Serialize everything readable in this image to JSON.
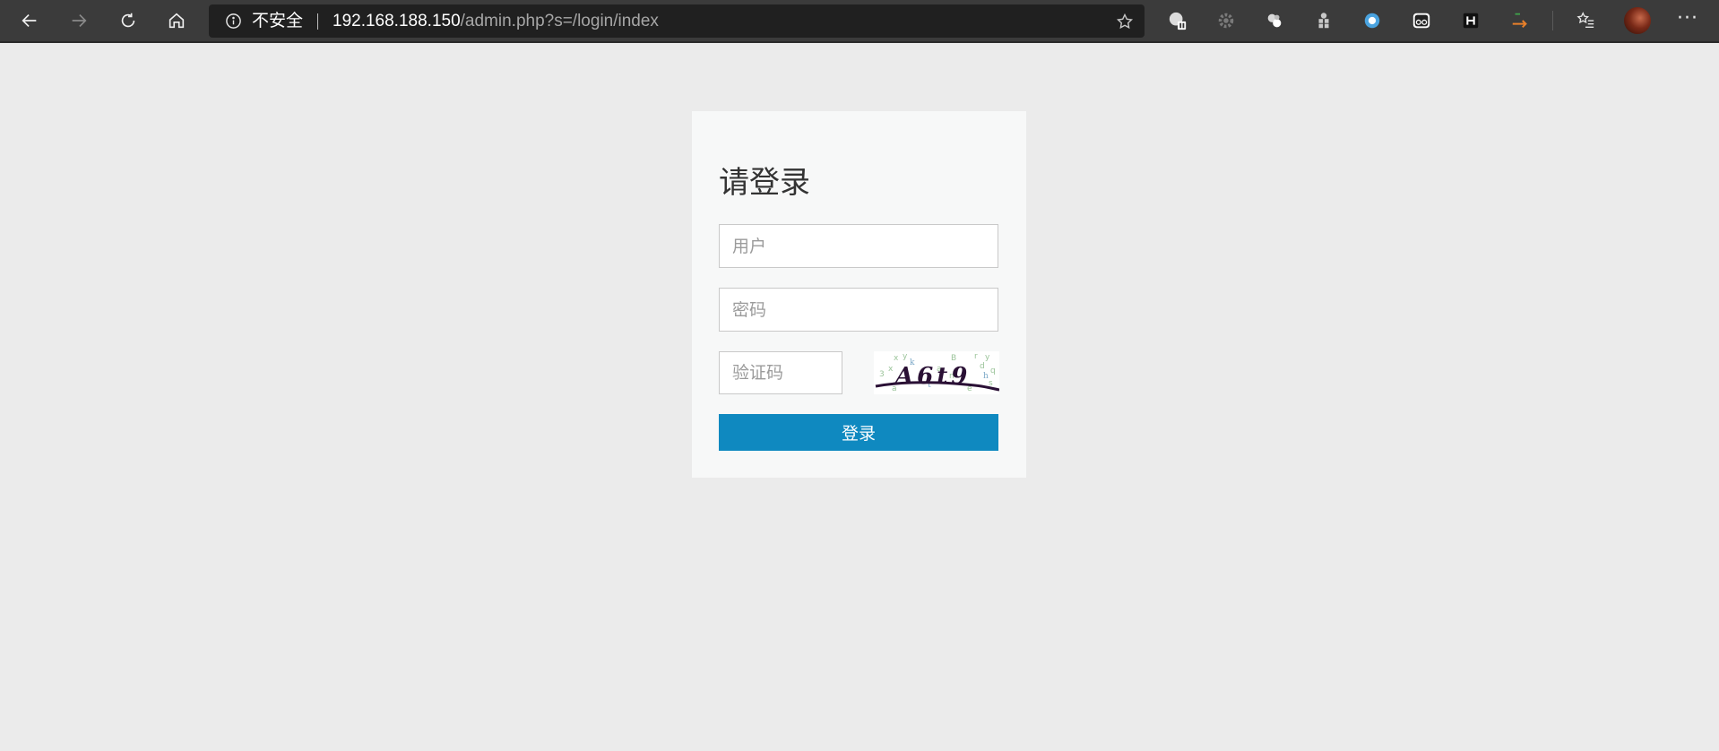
{
  "browser": {
    "address_bar": {
      "security_label": "不安全",
      "url_host": "192.168.188.150",
      "url_path": "/admin.php?s=/login/index"
    },
    "extensions": [
      "camera-pause-icon",
      "gear-icon",
      "bubbles-icon",
      "puzzle-icon",
      "ring-icon",
      "glasses-icon",
      "h-badge-icon",
      "arrow-icon"
    ]
  },
  "login": {
    "title": "请登录",
    "username_placeholder": "用户",
    "password_placeholder": "密码",
    "captcha_placeholder": "验证码",
    "captcha_text": "A6t9",
    "submit_label": "登录"
  },
  "colors": {
    "page_background": "#ebebeb",
    "card_background": "#f7f8f8",
    "button_background": "#0f89c0",
    "browser_toolbar": "#3b3b3b"
  }
}
